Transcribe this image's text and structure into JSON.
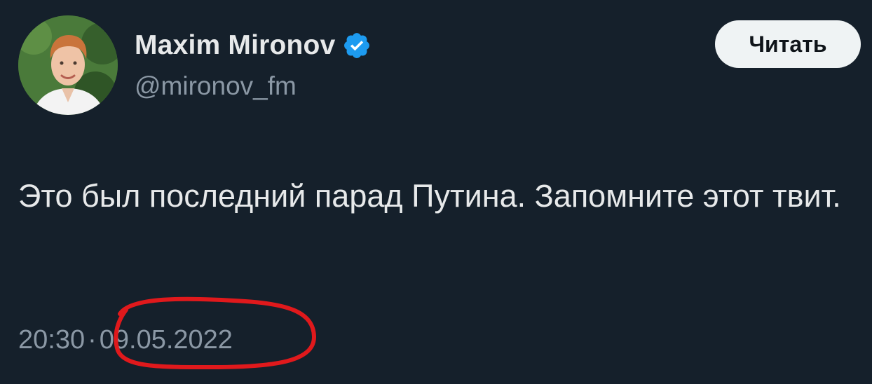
{
  "author": {
    "display_name": "Maxim Mironov",
    "handle": "@mironov_fm",
    "verified": true,
    "avatar_icon": "avatar-photo"
  },
  "actions": {
    "follow_label": "Читать"
  },
  "tweet": {
    "text": "Это был последний парад Путина. Запомните этот твит.",
    "time": "20:30",
    "separator": "·",
    "date": "09.05.2022"
  },
  "colors": {
    "background": "#15202b",
    "text_primary": "#e7e9ea",
    "text_secondary": "#8b98a5",
    "verified_blue": "#1d9bf0",
    "follow_bg": "#eff3f4",
    "annotation_red": "#e0191c"
  }
}
